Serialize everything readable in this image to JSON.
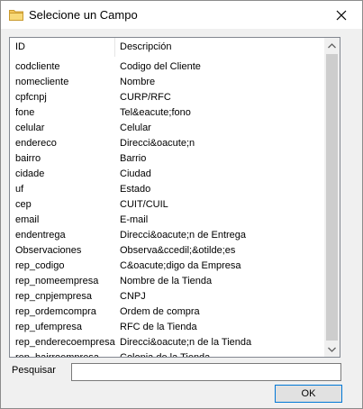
{
  "window": {
    "title": "Selecione un Campo"
  },
  "list": {
    "headers": {
      "id": "ID",
      "description": "Descripción"
    },
    "rows": [
      {
        "id": "codcliente",
        "description": "Codigo del Cliente"
      },
      {
        "id": "nomecliente",
        "description": "Nombre"
      },
      {
        "id": "cpfcnpj",
        "description": "CURP/RFC"
      },
      {
        "id": "fone",
        "description": "Tel&eacute;fono"
      },
      {
        "id": "celular",
        "description": "Celular"
      },
      {
        "id": "endereco",
        "description": "Direcci&oacute;n"
      },
      {
        "id": "bairro",
        "description": "Barrio"
      },
      {
        "id": "cidade",
        "description": "Ciudad"
      },
      {
        "id": "uf",
        "description": "Estado"
      },
      {
        "id": "cep",
        "description": "CUIT/CUIL"
      },
      {
        "id": "email",
        "description": "E-mail"
      },
      {
        "id": "endentrega",
        "description": "Direcci&oacute;n de Entrega"
      },
      {
        "id": "Observaciones",
        "description": "Observa&ccedil;&otilde;es"
      },
      {
        "id": "rep_codigo",
        "description": "C&oacute;digo da Empresa"
      },
      {
        "id": "rep_nomeempresa",
        "description": "Nombre de la Tienda"
      },
      {
        "id": "rep_cnpjempresa",
        "description": "CNPJ"
      },
      {
        "id": "rep_ordemcompra",
        "description": "Ordem de compra"
      },
      {
        "id": "rep_ufempresa",
        "description": "RFC de la Tienda"
      },
      {
        "id": "rep_enderecoempresa",
        "description": "Direcci&oacute;n de la Tienda"
      },
      {
        "id": "rep_bairroempresa",
        "description": "Colonia de la Tienda"
      }
    ]
  },
  "search": {
    "label": "Pesquisar",
    "value": ""
  },
  "buttons": {
    "ok_label": "OK"
  },
  "icons": {
    "title": "folder-icon",
    "close": "close-icon",
    "scroll_up": "chevron-up-icon",
    "scroll_down": "chevron-down-icon"
  },
  "colors": {
    "accent": "#0078d7",
    "folder": "#e8b840"
  }
}
